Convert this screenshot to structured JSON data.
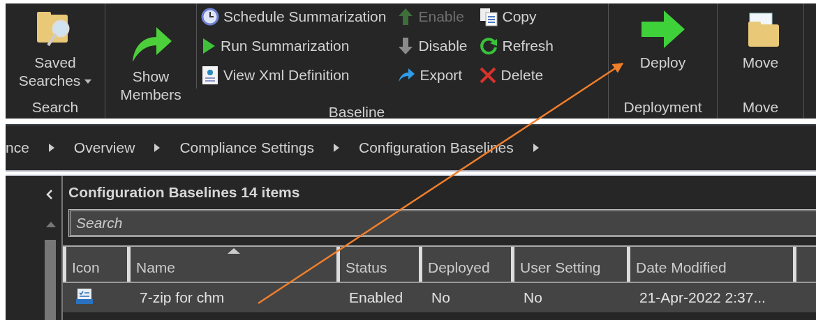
{
  "ribbon": {
    "groups": [
      {
        "label": "Search",
        "large": [
          {
            "label": "Saved Searches",
            "dropdown": true
          }
        ]
      },
      {
        "label": "Baseline",
        "large": [
          {
            "label": "Show Members",
            "dropdown": false
          }
        ],
        "columns": [
          [
            {
              "label": "Schedule Summarization",
              "disabled": false
            },
            {
              "label": "Run Summarization",
              "disabled": false
            },
            {
              "label": "View Xml Definition",
              "disabled": false
            }
          ],
          [
            {
              "label": "Enable",
              "disabled": true
            },
            {
              "label": "Disable",
              "disabled": false
            },
            {
              "label": "Export",
              "disabled": false
            }
          ],
          [
            {
              "label": "Copy",
              "disabled": false
            },
            {
              "label": "Refresh",
              "disabled": false
            },
            {
              "label": "Delete",
              "disabled": false
            }
          ]
        ]
      },
      {
        "label": "Deployment",
        "large": [
          {
            "label": "Deploy",
            "dropdown": false
          }
        ]
      },
      {
        "label": "Move",
        "large": [
          {
            "label": "Move",
            "dropdown": false
          }
        ]
      }
    ]
  },
  "breadcrumb": [
    "nce",
    "Overview",
    "Compliance Settings",
    "Configuration Baselines"
  ],
  "list": {
    "title": "Configuration Baselines 14 items",
    "search": {
      "placeholder": "Search"
    },
    "columns": [
      {
        "label": "Icon",
        "sorted": false
      },
      {
        "label": "Name",
        "sorted": true
      },
      {
        "label": "Status",
        "sorted": false
      },
      {
        "label": "Deployed",
        "sorted": false
      },
      {
        "label": "User Setting",
        "sorted": false
      },
      {
        "label": "Date Modified",
        "sorted": false
      }
    ],
    "rows": [
      {
        "selected": true,
        "cells": [
          "",
          "7-zip for chm",
          "Enabled",
          "No",
          "No",
          "21-Apr-2022 2:37..."
        ]
      }
    ]
  },
  "annotation": {
    "kind": "arrow"
  }
}
